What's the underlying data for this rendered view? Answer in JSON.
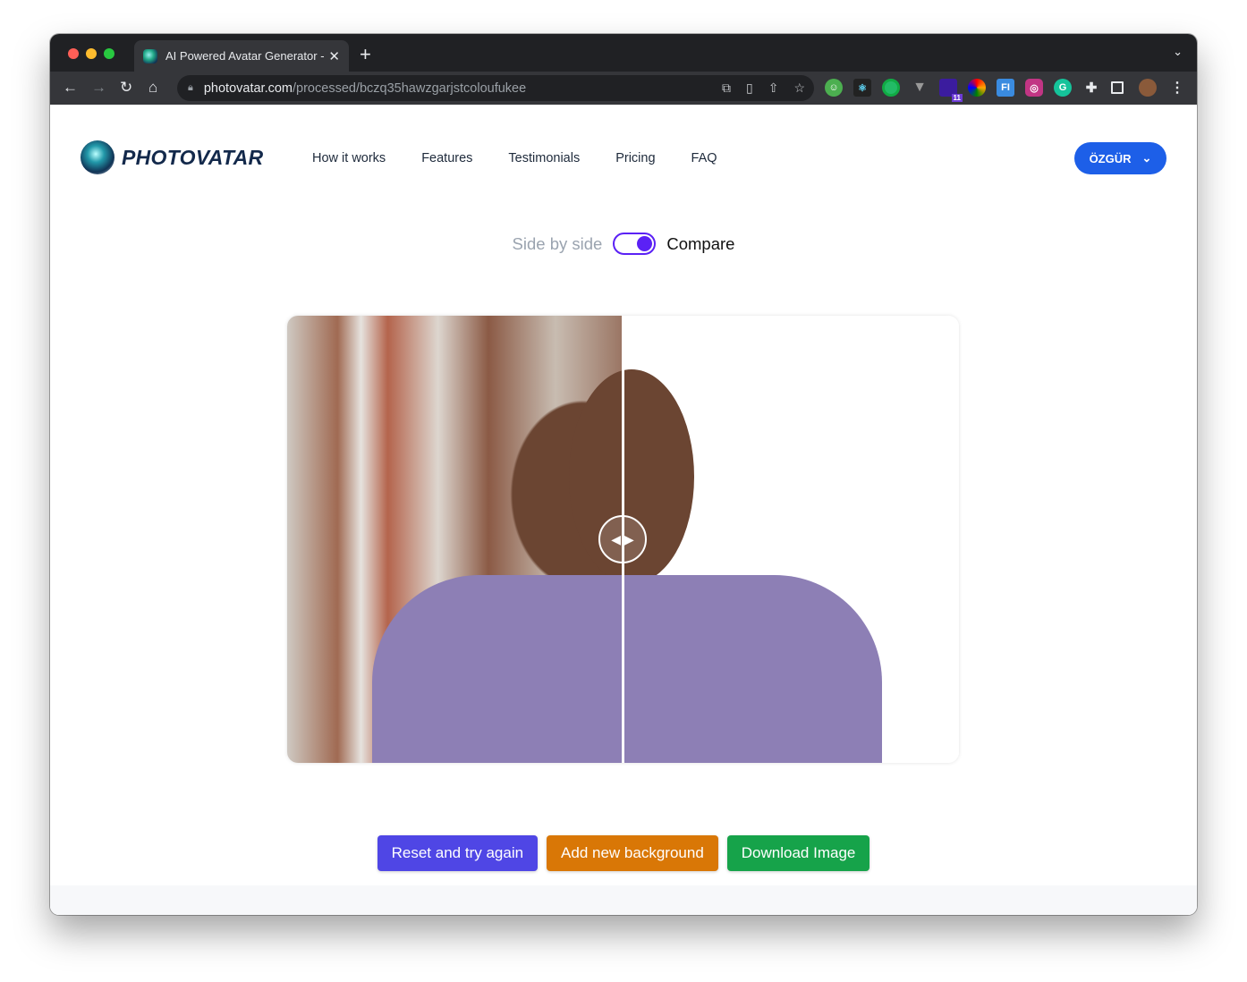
{
  "browser": {
    "tab_title": "AI Powered Avatar Generator -",
    "tab_close": "✕",
    "new_tab": "+",
    "url_host": "photovatar.com",
    "url_path": "/processed/bczq35hawzgarjstcoloufukee",
    "extension_badge": "11"
  },
  "header": {
    "logo": "PHOTOVATAR",
    "nav": [
      "How it works",
      "Features",
      "Testimonials",
      "Pricing",
      "FAQ"
    ],
    "user_button": "ÖZGÜR"
  },
  "view_toggle": {
    "left_label": "Side by side",
    "right_label": "Compare",
    "checked": true,
    "accent": "#5b21f5"
  },
  "actions": {
    "reset": {
      "label": "Reset and try again",
      "color": "#4f46e5"
    },
    "background": {
      "label": "Add new background",
      "color": "#d97706"
    },
    "download": {
      "label": "Download Image",
      "color": "#16a34a"
    }
  }
}
